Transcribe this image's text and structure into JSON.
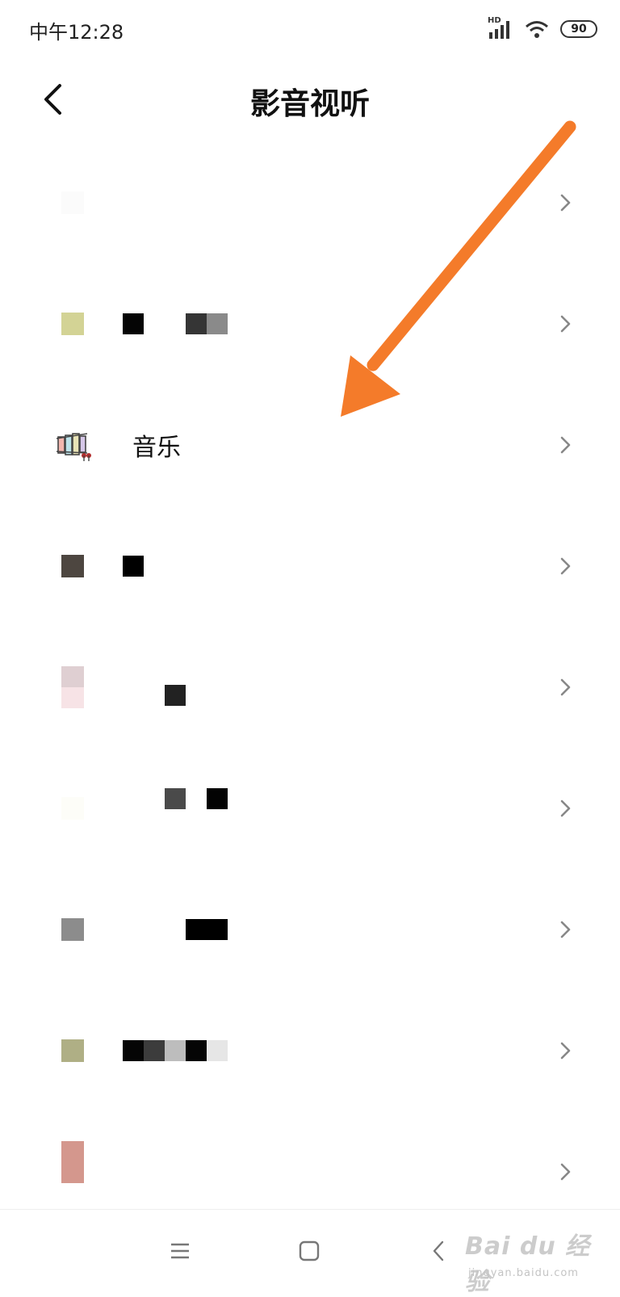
{
  "status_bar": {
    "time": "中午12:28",
    "signal_badge": "HD",
    "battery_level": "90",
    "icons": [
      "signal-icon",
      "wifi-icon",
      "battery-icon"
    ]
  },
  "header": {
    "title": "影音视听",
    "back_icon": "chevron-left-icon"
  },
  "list": {
    "music_label": "音乐",
    "row_count": 9,
    "chevron_icon": "chevron-right-icon"
  },
  "annotation": {
    "arrow_color": "#F47B2A"
  },
  "nav_bar": {
    "icons": [
      "menu-icon",
      "home-icon",
      "back-icon"
    ]
  },
  "watermark": {
    "brand": "Bai du 经验",
    "site": "jingyan.baidu.com"
  }
}
